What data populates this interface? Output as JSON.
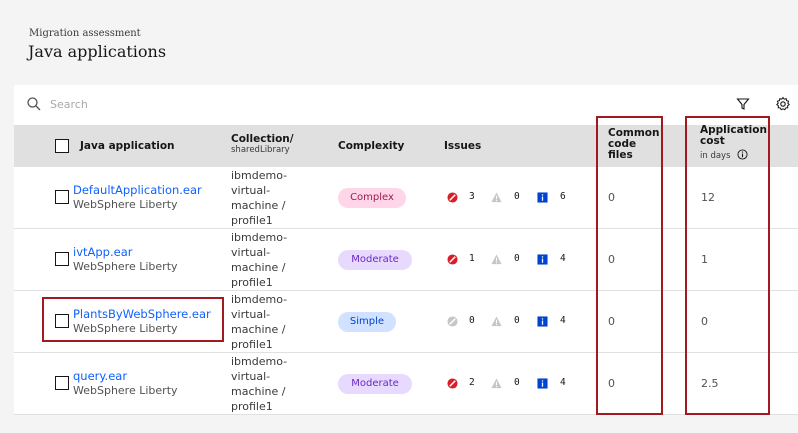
{
  "header": {
    "breadcrumb": "Migration assessment",
    "title": "Java applications"
  },
  "toolbar": {
    "search_placeholder": "Search",
    "search_icon": "search-icon",
    "filter_icon": "filter-icon",
    "settings_icon": "gear-icon"
  },
  "columns": {
    "app": "Java application",
    "collection": "Collection/",
    "collection_sub": "sharedLibrary",
    "complexity": "Complexity",
    "issues": "Issues",
    "common_code": [
      "Common",
      "code",
      "files"
    ],
    "cost": [
      "Application",
      "cost"
    ],
    "cost_sub": "in days",
    "cost_info_icon": "info-icon"
  },
  "rows": [
    {
      "name": "DefaultApplication.ear",
      "runtime": "WebSphere Liberty",
      "collection": [
        "ibmdemo-",
        "virtual-",
        "machine /",
        "profile1"
      ],
      "complexity": "Complex",
      "critical": "3",
      "warning": "0",
      "info": "6",
      "common_code": "0",
      "cost": "12"
    },
    {
      "name": "ivtApp.ear",
      "runtime": "WebSphere Liberty",
      "collection": [
        "ibmdemo-",
        "virtual-",
        "machine /",
        "profile1"
      ],
      "complexity": "Moderate",
      "critical": "1",
      "warning": "0",
      "info": "4",
      "common_code": "0",
      "cost": "1"
    },
    {
      "name": "PlantsByWebSphere.ear",
      "runtime": "WebSphere Liberty",
      "collection": [
        "ibmdemo-",
        "virtual-",
        "machine /",
        "profile1"
      ],
      "complexity": "Simple",
      "critical": "0",
      "warning": "0",
      "info": "4",
      "common_code": "0",
      "cost": "0"
    },
    {
      "name": "query.ear",
      "runtime": "WebSphere Liberty",
      "collection": [
        "ibmdemo-",
        "virtual-",
        "machine /",
        "profile1"
      ],
      "complexity": "Moderate",
      "critical": "2",
      "warning": "0",
      "info": "4",
      "common_code": "0",
      "cost": "2.5"
    }
  ],
  "colors": {
    "link": "#0f62fe",
    "critical": "#da1e28",
    "critical_muted": "#c6c6c6",
    "warning": "#c6c6c6",
    "info": "#0043ce",
    "highlight": "#a2191f"
  }
}
